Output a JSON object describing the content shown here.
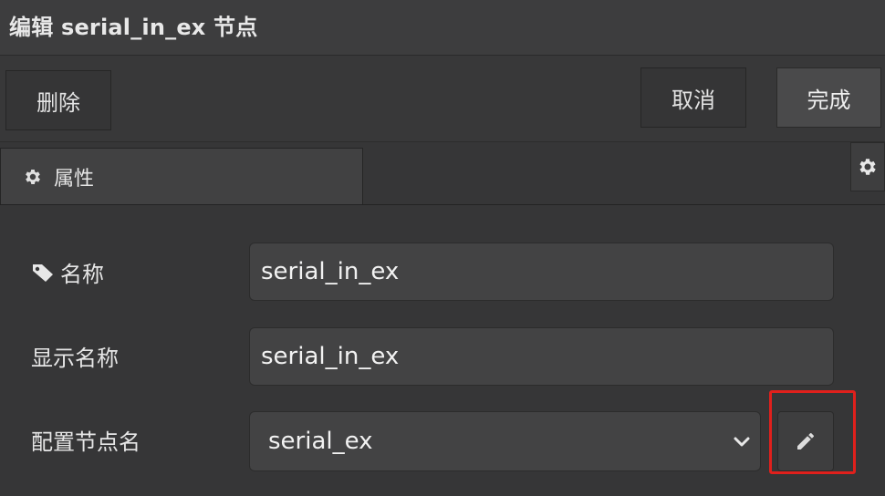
{
  "dialog": {
    "title": "编辑 serial_in_ex 节点"
  },
  "toolbar": {
    "delete_label": "删除",
    "cancel_label": "取消",
    "done_label": "完成"
  },
  "tabs": [
    {
      "label": "属性",
      "icon": "gear-icon"
    }
  ],
  "form": {
    "name": {
      "label": "名称",
      "icon": "tag-icon",
      "value": "serial_in_ex"
    },
    "display_name": {
      "label": "显示名称",
      "value": "serial_in_ex"
    },
    "config_node": {
      "label": "配置节点名",
      "value": "serial_ex",
      "edit_icon": "pencil-icon"
    }
  },
  "colors": {
    "highlight": "#e0201c"
  }
}
